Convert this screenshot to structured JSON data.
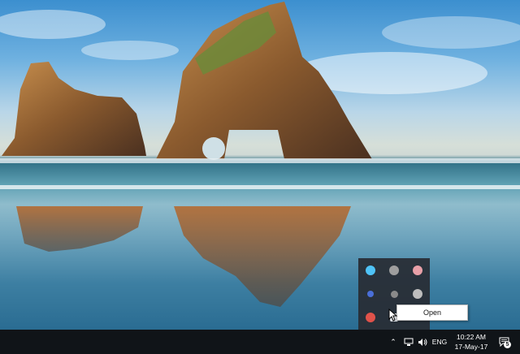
{
  "wallpaper": {
    "description_icon": "beach-rocks-wallpaper"
  },
  "tray_overflow": {
    "icons": [
      {
        "name": "cyan-tray-icon",
        "color": "#4fc3f7"
      },
      {
        "name": "gray-tray-icon-1",
        "color": "#9e9e9e"
      },
      {
        "name": "pink-tray-icon",
        "color": "#e8a0a8"
      },
      {
        "name": "blue-tray-icon",
        "color": "#4a6fd8"
      },
      {
        "name": "gray-tray-icon-2",
        "color": "#8a8a8a"
      },
      {
        "name": "gray-tray-icon-3",
        "color": "#bdbdbd"
      },
      {
        "name": "red-tray-icon",
        "color": "#e0524a"
      },
      {
        "name": "white-tray-icon",
        "color": "#d9dde2"
      }
    ]
  },
  "context_menu": {
    "open_label": "Open"
  },
  "taskbar": {
    "chevron": "⌃",
    "language": "ENG",
    "time": "10:22 AM",
    "date": "17-May-17",
    "notification_count": "5"
  }
}
